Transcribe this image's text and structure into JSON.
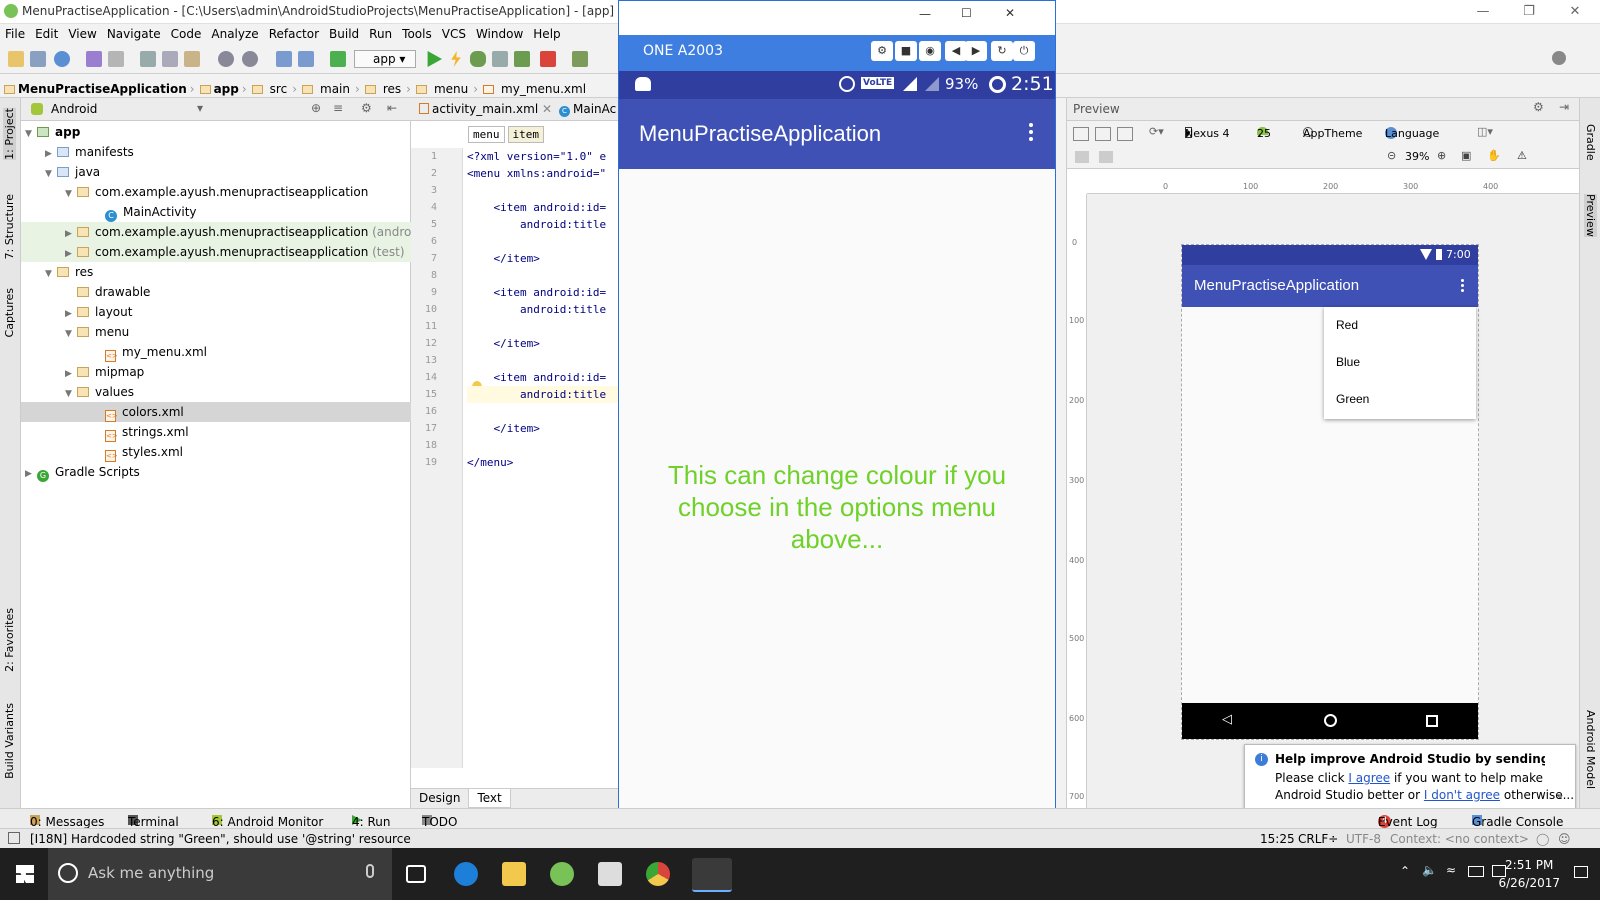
{
  "window": {
    "title": "MenuPractiseApplication - [C:\\Users\\admin\\AndroidStudioProjects\\MenuPractiseApplication] - [app] - ...\\app\\sr"
  },
  "menubar": [
    "File",
    "Edit",
    "View",
    "Navigate",
    "Code",
    "Analyze",
    "Refactor",
    "Build",
    "Run",
    "Tools",
    "VCS",
    "Window",
    "Help"
  ],
  "toolbar": {
    "config": "app"
  },
  "breadcrumb": [
    "MenuPractiseApplication",
    "app",
    "src",
    "main",
    "res",
    "menu",
    "my_menu.xml"
  ],
  "left_strip": {
    "project": "1: Project",
    "structure": "7: Structure",
    "captures": "Captures",
    "favorites": "2: Favorites",
    "build_variants": "Build Variants"
  },
  "right_strip": {
    "gradle": "Gradle",
    "preview": "Preview",
    "android_model": "Android Model"
  },
  "project_panel": {
    "view": "Android",
    "tree": [
      {
        "label": "app",
        "icon": "module"
      },
      {
        "label": "manifests",
        "icon": "folder"
      },
      {
        "label": "java",
        "icon": "folder"
      },
      {
        "label": "com.example.ayush.menupractiseapplication",
        "icon": "package"
      },
      {
        "label": "MainActivity",
        "icon": "class"
      },
      {
        "label": "com.example.ayush.menupractiseapplication",
        "suffix": "(androidTest",
        "icon": "package"
      },
      {
        "label": "com.example.ayush.menupractiseapplication",
        "suffix": "(test)",
        "icon": "package"
      },
      {
        "label": "res",
        "icon": "folder"
      },
      {
        "label": "drawable",
        "icon": "folder"
      },
      {
        "label": "layout",
        "icon": "folder"
      },
      {
        "label": "menu",
        "icon": "folder"
      },
      {
        "label": "my_menu.xml",
        "icon": "xml"
      },
      {
        "label": "mipmap",
        "icon": "folder"
      },
      {
        "label": "values",
        "icon": "folder"
      },
      {
        "label": "colors.xml",
        "icon": "xml"
      },
      {
        "label": "strings.xml",
        "icon": "xml"
      },
      {
        "label": "styles.xml",
        "icon": "xml"
      },
      {
        "label": "Gradle Scripts",
        "icon": "gradle"
      }
    ]
  },
  "editor": {
    "tabs": [
      "activity_main.xml",
      "MainAc"
    ],
    "crumbs": [
      "menu",
      "item"
    ],
    "lines": [
      {
        "n": "1",
        "text": "<?xml version=\"1.0\" e"
      },
      {
        "n": "2",
        "text": "<menu xmlns:android=\""
      },
      {
        "n": "3",
        "text": ""
      },
      {
        "n": "4",
        "text": "    <item android:id="
      },
      {
        "n": "5",
        "text": "        android:title"
      },
      {
        "n": "6",
        "text": ""
      },
      {
        "n": "7",
        "text": "    </item>"
      },
      {
        "n": "8",
        "text": ""
      },
      {
        "n": "9",
        "text": "    <item android:id="
      },
      {
        "n": "10",
        "text": "        android:title"
      },
      {
        "n": "11",
        "text": ""
      },
      {
        "n": "12",
        "text": "    </item>"
      },
      {
        "n": "13",
        "text": ""
      },
      {
        "n": "14",
        "text": "    <item android:id="
      },
      {
        "n": "15",
        "text": "        android:title"
      },
      {
        "n": "16",
        "text": ""
      },
      {
        "n": "17",
        "text": "    </item>"
      },
      {
        "n": "18",
        "text": ""
      },
      {
        "n": "19",
        "text": "</menu>"
      }
    ],
    "design_tab": "Design",
    "text_tab": "Text"
  },
  "emulator": {
    "device": "ONE A2003",
    "battery": "93%",
    "time": "2:51",
    "volte": "VoLTE",
    "app_title": "MenuPractiseApplication",
    "main_text": "This can change colour if you choose in the options menu above...",
    "text_color": "#6fd12a"
  },
  "preview": {
    "label": "Preview",
    "device": "Nexus 4",
    "api": "25",
    "theme": "AppTheme",
    "language": "Language",
    "zoom": "39%",
    "ruler_h": [
      "0",
      "100",
      "200",
      "300",
      "400"
    ],
    "ruler_v": [
      "0",
      "100",
      "200",
      "300",
      "400",
      "500",
      "600",
      "700"
    ],
    "phone_time": "7:00",
    "app_title": "MenuPractiseApplication",
    "menu_items": [
      "Red",
      "Blue",
      "Green"
    ]
  },
  "notification": {
    "title": "Help improve Android Studio by sending usage st",
    "line1_pre": "Please click ",
    "agree": "I agree",
    "line1_post": " if you want to help make",
    "line2_pre": "Android Studio better or ",
    "disagree": "I don't agree",
    "line2_post": " otherwise..."
  },
  "bottom_tabs": {
    "messages": "0: Messages",
    "terminal": "Terminal",
    "monitor": "6: Android Monitor",
    "run": "4: Run",
    "todo": "TODO",
    "event_log": "Event Log",
    "event_count": "4",
    "gradle_console": "Gradle Console"
  },
  "status": {
    "message": "[I18N] Hardcoded string \"Green\", should use '@string' resource",
    "position": "15:25",
    "line_sep": "CRLF÷",
    "encoding": "UTF-8",
    "context": "Context: <no context>"
  },
  "taskbar": {
    "search_placeholder": "Ask me anything",
    "time": "2:51 PM",
    "date": "6/26/2017"
  }
}
